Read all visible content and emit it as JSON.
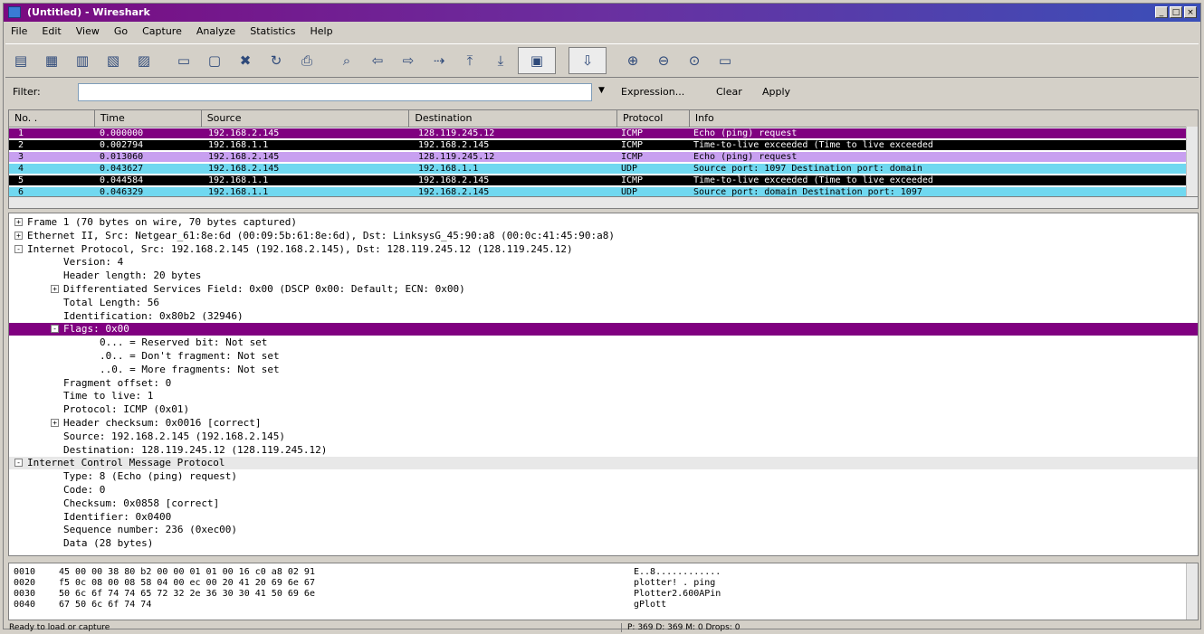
{
  "window": {
    "title": "(Untitled) - Wireshark",
    "buttons": [
      "_",
      "□",
      "×"
    ]
  },
  "menu": [
    "File",
    "Edit",
    "View",
    "Go",
    "Capture",
    "Analyze",
    "Statistics",
    "Help"
  ],
  "toolbar": [
    {
      "name": "list-interfaces-icon",
      "glyph": "▤"
    },
    {
      "name": "capture-options-icon",
      "glyph": "▦"
    },
    {
      "name": "start-capture-icon",
      "glyph": "▥"
    },
    {
      "name": "stop-capture-icon",
      "glyph": "▧"
    },
    {
      "name": "restart-capture-icon",
      "glyph": "▨"
    },
    {
      "name": "open-file-icon",
      "glyph": "▭"
    },
    {
      "name": "save-file-icon",
      "glyph": "▢"
    },
    {
      "name": "close-file-icon",
      "glyph": "✖"
    },
    {
      "name": "reload-icon",
      "glyph": "↻"
    },
    {
      "name": "print-icon",
      "glyph": "⎙"
    },
    {
      "name": "find-packet-icon",
      "glyph": "⌕"
    },
    {
      "name": "go-back-icon",
      "glyph": "⇦"
    },
    {
      "name": "go-forward-icon",
      "glyph": "⇨"
    },
    {
      "name": "go-to-packet-icon",
      "glyph": "⇢"
    },
    {
      "name": "go-first-icon",
      "glyph": "⤒"
    },
    {
      "name": "go-last-icon",
      "glyph": "⤓"
    },
    {
      "name": "colorize-icon",
      "glyph": "▣"
    },
    {
      "name": "autoscroll-icon",
      "glyph": "⇩"
    },
    {
      "name": "zoom-in-icon",
      "glyph": "⊕"
    },
    {
      "name": "zoom-out-icon",
      "glyph": "⊖"
    },
    {
      "name": "zoom-normal-icon",
      "glyph": "⊙"
    },
    {
      "name": "resize-columns-icon",
      "glyph": "▭"
    }
  ],
  "filter": {
    "label": "Filter:",
    "value": "",
    "expression": "Expression...",
    "clear": "Clear",
    "apply": "Apply"
  },
  "packet_list": {
    "columns": [
      "No. .",
      "Time",
      "Source",
      "Destination",
      "Protocol",
      "Info"
    ],
    "rows": [
      {
        "no": "1",
        "time": "0.000000",
        "src": "192.168.2.145",
        "dst": "128.119.245.12",
        "proto": "ICMP",
        "info": "Echo (ping) request",
        "bg": "#800080",
        "fg": "#ffffff"
      },
      {
        "no": "2",
        "time": "0.002794",
        "src": "192.168.1.1",
        "dst": "192.168.2.145",
        "proto": "ICMP",
        "info": "Time-to-live exceeded (Time to live exceeded",
        "bg": "#000000",
        "fg": "#ffffff"
      },
      {
        "no": "3",
        "time": "0.013060",
        "src": "192.168.2.145",
        "dst": "128.119.245.12",
        "proto": "ICMP",
        "info": "Echo (ping) request",
        "bg": "#c8a0f0",
        "fg": "#000000"
      },
      {
        "no": "4",
        "time": "0.043627",
        "src": "192.168.2.145",
        "dst": "192.168.1.1",
        "proto": "UDP",
        "info": "Source port: 1097  Destination port: domain",
        "bg": "#70d8f0",
        "fg": "#000000"
      },
      {
        "no": "5",
        "time": "0.044584",
        "src": "192.168.1.1",
        "dst": "192.168.2.145",
        "proto": "ICMP",
        "info": "Time-to-live exceeded (Time to live exceeded",
        "bg": "#000000",
        "fg": "#ffffff"
      },
      {
        "no": "6",
        "time": "0.046329",
        "src": "192.168.1.1",
        "dst": "192.168.2.145",
        "proto": "UDP",
        "info": "Source port: domain  Destination port: 1097",
        "bg": "#70d8f0",
        "fg": "#000000"
      }
    ]
  },
  "details": [
    {
      "text": "Frame 1 (70 bytes on wire, 70 bytes captured)",
      "indent": 0,
      "exp": "+"
    },
    {
      "text": "Ethernet II, Src: Netgear_61:8e:6d (00:09:5b:61:8e:6d), Dst: LinksysG_45:90:a8 (00:0c:41:45:90:a8)",
      "indent": 0,
      "exp": "+"
    },
    {
      "text": "Internet Protocol, Src: 192.168.2.145 (192.168.2.145), Dst: 128.119.245.12 (128.119.245.12)",
      "indent": 0,
      "exp": "-"
    },
    {
      "text": "Version: 4",
      "indent": 1,
      "exp": ""
    },
    {
      "text": "Header length: 20 bytes",
      "indent": 1,
      "exp": ""
    },
    {
      "text": "Differentiated Services Field: 0x00 (DSCP 0x00: Default; ECN: 0x00)",
      "indent": 1,
      "exp": "+"
    },
    {
      "text": "Total Length: 56",
      "indent": 1,
      "exp": ""
    },
    {
      "text": "Identification: 0x80b2 (32946)",
      "indent": 1,
      "exp": ""
    },
    {
      "text": "Flags: 0x00",
      "indent": 1,
      "exp": "-",
      "sel": true
    },
    {
      "text": "0... = Reserved bit: Not set",
      "indent": 2,
      "exp": ""
    },
    {
      "text": ".0.. = Don't fragment: Not set",
      "indent": 2,
      "exp": ""
    },
    {
      "text": "..0. = More fragments: Not set",
      "indent": 2,
      "exp": ""
    },
    {
      "text": "Fragment offset: 0",
      "indent": 1,
      "exp": ""
    },
    {
      "text": "Time to live: 1",
      "indent": 1,
      "exp": ""
    },
    {
      "text": "Protocol: ICMP (0x01)",
      "indent": 1,
      "exp": ""
    },
    {
      "text": "Header checksum: 0x0016 [correct]",
      "indent": 1,
      "exp": "+"
    },
    {
      "text": "Source: 192.168.2.145 (192.168.2.145)",
      "indent": 1,
      "exp": ""
    },
    {
      "text": "Destination: 128.119.245.12 (128.119.245.12)",
      "indent": 1,
      "exp": ""
    },
    {
      "text": "Internet Control Message Protocol",
      "indent": 0,
      "exp": "-",
      "hl": true
    },
    {
      "text": "Type: 8 (Echo (ping) request)",
      "indent": 1,
      "exp": ""
    },
    {
      "text": "Code: 0",
      "indent": 1,
      "exp": ""
    },
    {
      "text": "Checksum: 0x0858 [correct]",
      "indent": 1,
      "exp": ""
    },
    {
      "text": "Identifier: 0x0400",
      "indent": 1,
      "exp": ""
    },
    {
      "text": "Sequence number: 236 (0xec00)",
      "indent": 1,
      "exp": ""
    },
    {
      "text": "Data (28 bytes)",
      "indent": 1,
      "exp": ""
    }
  ],
  "hex": [
    {
      "off": "0010",
      "bytes": "45 00 00 38 80 b2 00 00 01 01 00 16 c0 a8 02 91",
      "ascii": "E..8............"
    },
    {
      "off": "0020",
      "bytes": "f5 0c 08 00 08 58 04 00 ec 00 20 41 20 69 6e 67",
      "ascii": "plotter!  .  ping"
    },
    {
      "off": "0030",
      "bytes": "50 6c 6f 74 74 65 72 32 2e 36 30 30 41 50 69 6e",
      "ascii": "Plotter2.600APin"
    },
    {
      "off": "0040",
      "bytes": "67 50 6c 6f 74 74",
      "ascii": "gPlott"
    }
  ],
  "status": {
    "left": "Ready to load or capture",
    "right": "P: 369 D: 369 M: 0 Drops: 0"
  }
}
